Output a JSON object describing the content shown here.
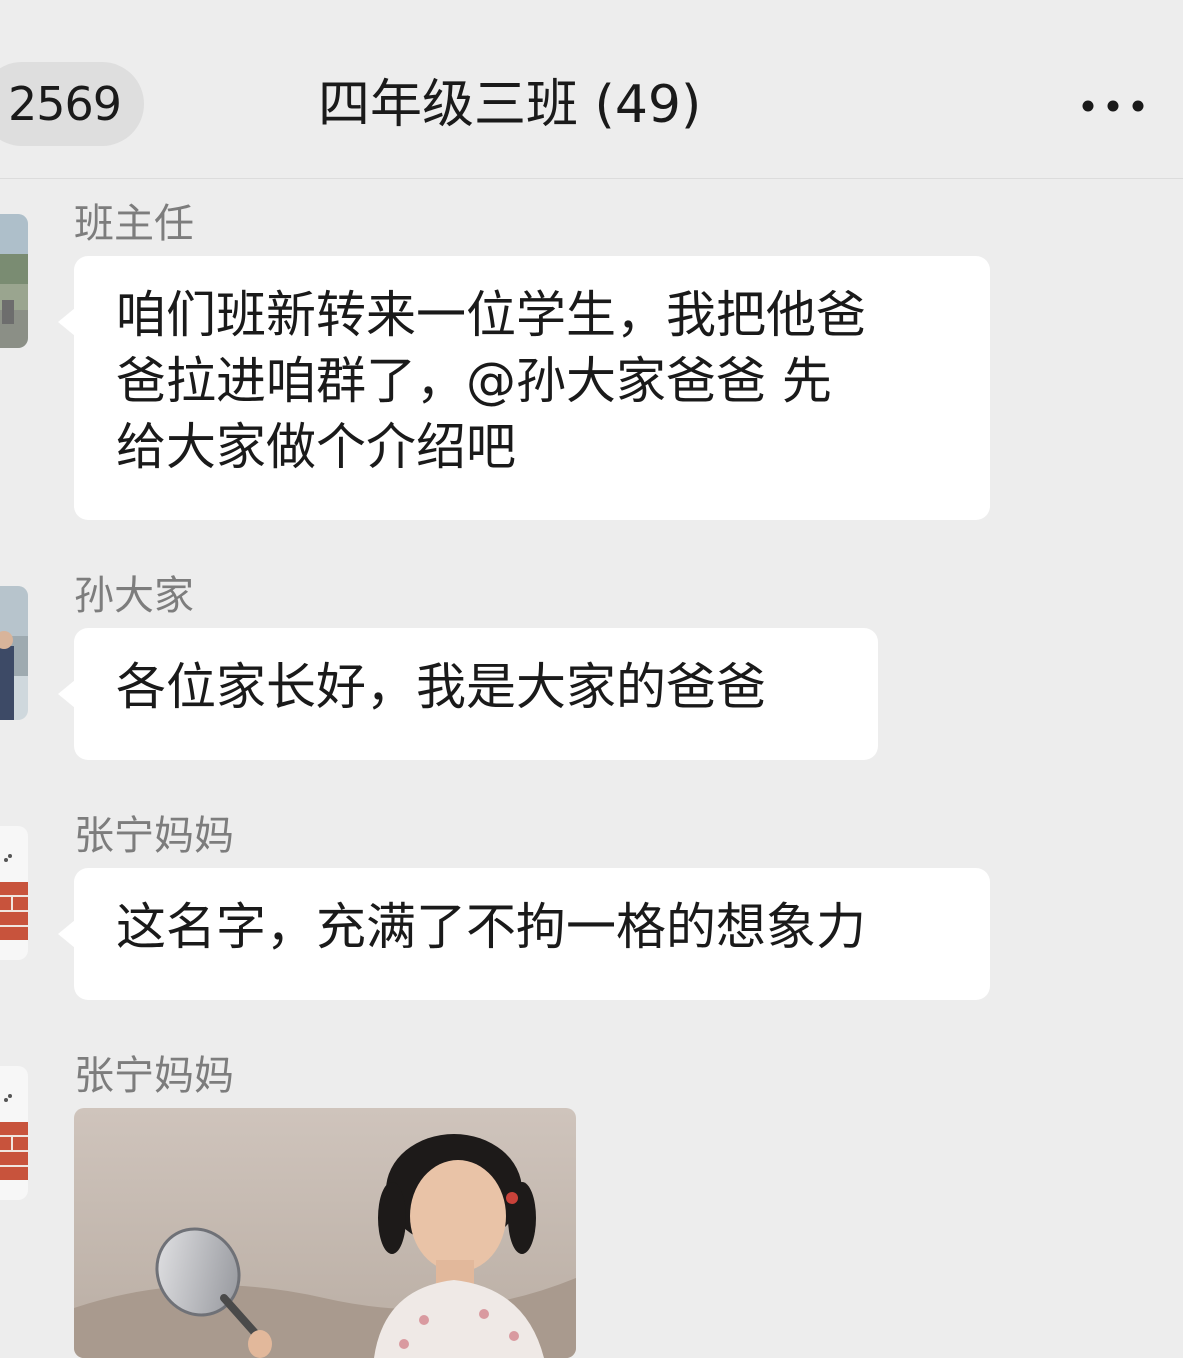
{
  "header": {
    "unread_count": "2569",
    "title": "四年级三班 (49)"
  },
  "icons": {
    "more": "more-horizontal-icon"
  },
  "messages": [
    {
      "sender": "班主任",
      "lines": [
        "咱们班新转来一位学生，我把他爸",
        "爸拉进咱群了，@孙大家爸爸 先",
        "给大家做个介绍吧"
      ]
    },
    {
      "sender": "孙大家",
      "lines": [
        "各位家长好，我是大家的爸爸"
      ]
    },
    {
      "sender": "张宁妈妈",
      "lines": [
        "这名字，充满了不拘一格的想象力"
      ]
    },
    {
      "sender": "张宁妈妈",
      "type": "image"
    }
  ]
}
